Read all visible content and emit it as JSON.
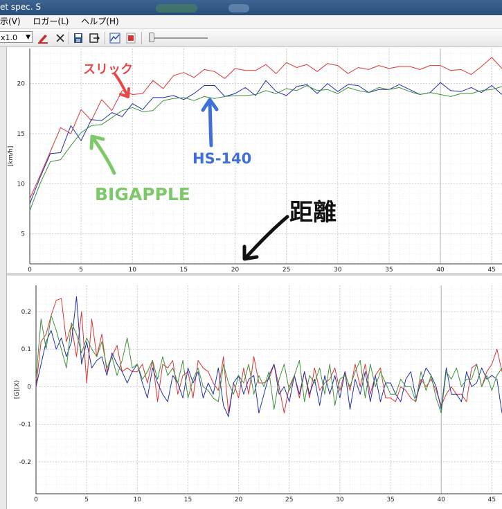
{
  "window": {
    "title": "et spec. S"
  },
  "menu": {
    "items": [
      "表示(V)",
      "ロガー(L)",
      "ヘルプ(H)"
    ]
  },
  "menu_visible": [
    "示(V)",
    "ロガー(L)",
    "ヘルプ(H)"
  ],
  "toolbar": {
    "zoom_value": "x1.0"
  },
  "colors": {
    "red": "#d93434",
    "blue": "#2030a8",
    "green": "#3f8f3a",
    "annot_red": "#e8474a",
    "annot_blue": "#3f6fd8",
    "annot_green": "#7dc96a"
  },
  "annotations": {
    "slick": "スリック",
    "hs140": "HS-140",
    "bigapple": "BIGAPPLE",
    "distance": "距離"
  },
  "chart_data": [
    {
      "type": "line",
      "ylabel": "[km/h]",
      "xlim": [
        0,
        46
      ],
      "ylim": [
        2,
        23.5
      ],
      "xticks": [
        0,
        5,
        10,
        15,
        20,
        25,
        30,
        35,
        40,
        45
      ],
      "yticks": [
        5,
        10,
        15,
        20
      ],
      "x": [
        0,
        1,
        2,
        3,
        4,
        5,
        6,
        7,
        8,
        9,
        10,
        11,
        12,
        13,
        14,
        15,
        16,
        17,
        18,
        19,
        20,
        21,
        22,
        23,
        24,
        25,
        26,
        27,
        28,
        29,
        30,
        31,
        32,
        33,
        34,
        35,
        36,
        37,
        38,
        39,
        40,
        41,
        42,
        43,
        44,
        45,
        46
      ],
      "series": [
        {
          "color": "red",
          "values": [
            8.5,
            10.8,
            13.2,
            15.6,
            15.0,
            17.4,
            16.3,
            18.4,
            17.3,
            19.3,
            18.9,
            19.0,
            20.3,
            19.5,
            20.8,
            21.1,
            20.6,
            21.4,
            21.2,
            20.5,
            21.5,
            21.3,
            21.3,
            21.9,
            21.0,
            22.1,
            21.6,
            21.9,
            21.2,
            22.0,
            21.8,
            21.0,
            21.6,
            21.4,
            21.8,
            21.5,
            21.7,
            21.7,
            21.4,
            21.8,
            21.8,
            21.3,
            21.4,
            20.9,
            21.7,
            22.6,
            21.5
          ]
        },
        {
          "color": "blue",
          "values": [
            8.0,
            10.6,
            13.0,
            13.1,
            15.8,
            14.3,
            16.4,
            16.3,
            17.1,
            16.7,
            18.0,
            17.4,
            18.6,
            18.6,
            18.8,
            18.4,
            19.0,
            19.8,
            19.8,
            18.7,
            19.0,
            19.6,
            18.8,
            20.3,
            19.2,
            18.8,
            19.7,
            19.9,
            19.0,
            20.0,
            19.2,
            19.9,
            19.8,
            19.1,
            19.4,
            19.4,
            19.9,
            19.4,
            18.9,
            19.1,
            20.1,
            19.3,
            19.2,
            19.6,
            19.1,
            19.8,
            18.9
          ]
        },
        {
          "color": "green",
          "values": [
            7.3,
            10.0,
            12.2,
            12.4,
            13.8,
            15.1,
            15.8,
            15.9,
            16.6,
            17.3,
            17.6,
            17.2,
            17.3,
            18.3,
            18.5,
            18.6,
            18.3,
            18.7,
            18.5,
            18.7,
            18.8,
            18.8,
            18.9,
            19.3,
            19.0,
            19.5,
            19.3,
            19.8,
            19.3,
            19.4,
            19.0,
            19.6,
            19.3,
            19.1,
            19.6,
            19.4,
            19.6,
            19.2,
            18.9,
            19.1,
            18.9,
            18.7,
            19.0,
            19.0,
            19.3,
            19.4,
            19.7
          ]
        }
      ]
    },
    {
      "type": "line",
      "ylabel": "[G](X)",
      "xlim": [
        0,
        46
      ],
      "ylim": [
        -0.285,
        0.27
      ],
      "xticks": [
        0,
        5,
        10,
        15,
        20,
        25,
        30,
        35,
        40,
        45
      ],
      "yticks": [
        -0.2,
        -0.1,
        0,
        0.1,
        0.2
      ],
      "x": [
        0,
        0.5,
        1,
        1.5,
        2,
        2.5,
        3,
        3.5,
        4,
        4.5,
        5,
        5.5,
        6,
        6.5,
        7,
        7.5,
        8,
        8.5,
        9,
        9.5,
        10,
        10.5,
        11,
        11.5,
        12,
        12.5,
        13,
        13.5,
        14,
        14.5,
        15,
        15.5,
        16,
        16.5,
        17,
        17.5,
        18,
        18.5,
        19,
        19.5,
        20,
        20.5,
        21,
        21.5,
        22,
        22.5,
        23,
        23.5,
        24,
        24.5,
        25,
        25.5,
        26,
        26.5,
        27,
        27.5,
        28,
        28.5,
        29,
        29.5,
        30,
        30.5,
        31,
        31.5,
        32,
        32.5,
        33,
        33.5,
        34,
        34.5,
        35,
        35.5,
        36,
        36.5,
        37,
        37.5,
        38,
        38.5,
        39,
        39.5,
        40,
        40.5,
        41,
        41.5,
        42,
        42.5,
        43,
        43.5,
        44,
        44.5,
        45,
        45.5,
        46
      ],
      "series": [
        {
          "color": "red",
          "values": [
            0.0,
            0.12,
            0.14,
            0.19,
            0.23,
            0.235,
            0.12,
            0.165,
            0.08,
            0.2,
            0.01,
            0.18,
            0.08,
            0.14,
            0.04,
            0.08,
            0.11,
            0.04,
            0.05,
            0.04,
            0.04,
            0.06,
            0.01,
            0.07,
            -0.04,
            0.06,
            0.05,
            0.07,
            -0.02,
            0.03,
            0.04,
            -0.03,
            0.07,
            0.05,
            0.04,
            0.01,
            -0.01,
            0.08,
            -0.07,
            0.01,
            -0.03,
            0.05,
            -0.02,
            0.08,
            0.01,
            0.01,
            0.02,
            0.06,
            0.0,
            -0.07,
            0.0,
            0.03,
            -0.03,
            0.04,
            -0.03,
            0.05,
            -0.01,
            0.01,
            0.02,
            0.05,
            -0.01,
            0.04,
            -0.01,
            0.06,
            0.0,
            0.06,
            -0.02,
            0.03,
            0.05,
            -0.03,
            -0.03,
            -0.04,
            0.0,
            -0.01,
            -0.03,
            -0.04,
            0.02,
            0.0,
            0.02,
            -0.01,
            -0.05,
            -0.02,
            0.0,
            -0.02,
            -0.02,
            -0.04,
            0.05,
            0.06,
            0.0,
            0.04,
            0.06,
            0.1,
            0.04
          ]
        },
        {
          "color": "blue",
          "values": [
            0.0,
            0.06,
            0.12,
            0.15,
            0.1,
            0.13,
            0.08,
            0.12,
            0.24,
            0.06,
            0.12,
            0.05,
            0.07,
            0.08,
            0.03,
            0.09,
            0.06,
            0.04,
            0.01,
            0.04,
            0.06,
            0.01,
            -0.03,
            0.05,
            0.01,
            -0.02,
            -0.04,
            0.03,
            0.01,
            -0.03,
            0.05,
            0.01,
            0.04,
            -0.03,
            0.01,
            -0.02,
            0.05,
            -0.05,
            -0.08,
            0.01,
            0.03,
            -0.02,
            0.02,
            0.03,
            -0.07,
            -0.02,
            0.03,
            0.06,
            -0.02,
            0.0,
            -0.04,
            0.03,
            -0.02,
            0.04,
            -0.02,
            0.02,
            -0.05,
            0.03,
            -0.02,
            0.03,
            -0.03,
            0.04,
            -0.06,
            0.02,
            -0.02,
            0.04,
            -0.04,
            0.03,
            -0.04,
            0.01,
            0.01,
            -0.02,
            -0.04,
            0.02,
            0.04,
            -0.03,
            0.01,
            0.05,
            0.03,
            0.0,
            -0.06,
            0.05,
            -0.02,
            -0.02,
            -0.04,
            0.04,
            0.0,
            0.01,
            0.05,
            0.02,
            0.03,
            0.02,
            -0.07
          ]
        },
        {
          "color": "green",
          "values": [
            0.02,
            0.18,
            0.1,
            0.19,
            0.15,
            0.1,
            0.05,
            0.17,
            0.14,
            0.09,
            0.13,
            0.1,
            0.08,
            0.12,
            0.05,
            0.08,
            0.03,
            0.07,
            0.13,
            0.05,
            0.06,
            0.02,
            0.04,
            0.07,
            0.02,
            0.08,
            0.03,
            0.05,
            0.01,
            0.07,
            -0.03,
            0.02,
            0.05,
            0.0,
            -0.01,
            -0.03,
            -0.04,
            0.06,
            0.01,
            -0.02,
            0.03,
            0.01,
            0.06,
            -0.02,
            0.03,
            0.0,
            0.04,
            -0.06,
            0.02,
            0.06,
            -0.01,
            0.03,
            0.07,
            -0.04,
            0.03,
            0.01,
            0.05,
            -0.02,
            0.06,
            -0.05,
            0.02,
            0.03,
            0.0,
            0.04,
            0.07,
            -0.03,
            0.06,
            0.0,
            0.04,
            0.01,
            -0.02,
            -0.02,
            0.02,
            0.0,
            0.0,
            -0.04,
            0.04,
            -0.01,
            0.03,
            -0.03,
            -0.07,
            0.04,
            0.02,
            0.05,
            0.0,
            0.02,
            0.02,
            0.06,
            0.0,
            0.03,
            -0.01,
            0.03,
            0.05
          ]
        }
      ]
    }
  ]
}
